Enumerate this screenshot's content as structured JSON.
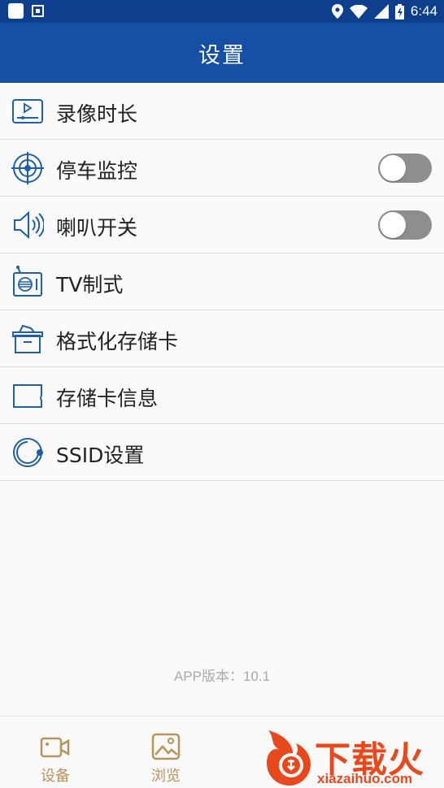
{
  "status_bar": {
    "time": "6:44",
    "icons": [
      "notification-square-icon",
      "a-box-icon",
      "location-icon",
      "wifi-icon",
      "signal-icon",
      "battery-icon"
    ]
  },
  "app_bar": {
    "title": "设置"
  },
  "settings": [
    {
      "label": "录像时长",
      "icon": "video-length-icon"
    },
    {
      "label": "停车监控",
      "icon": "parking-monitor-icon",
      "toggle": false
    },
    {
      "label": "喇叭开关",
      "icon": "speaker-icon",
      "toggle": false
    },
    {
      "label": "TV制式",
      "icon": "tv-radio-icon"
    },
    {
      "label": "格式化存储卡",
      "icon": "format-box-icon"
    },
    {
      "label": "存储卡信息",
      "icon": "sd-card-icon"
    },
    {
      "label": "SSID设置",
      "icon": "ssid-ring-icon"
    }
  ],
  "version_text": "APP版本：10.1",
  "tabs": [
    {
      "label": "设备",
      "icon": "camera-icon"
    },
    {
      "label": "浏览",
      "icon": "gallery-icon"
    }
  ],
  "watermark": {
    "brand": "下载火",
    "url": "xiazaihuo.com"
  },
  "colors": {
    "appbar": "#1550a4",
    "statusbar": "#0d3f8c",
    "icon_blue": "#1f5fa8",
    "tab_gold": "#b8935a",
    "toggle_off": "#8e8e8e",
    "watermark_orange": "#e8481c"
  }
}
